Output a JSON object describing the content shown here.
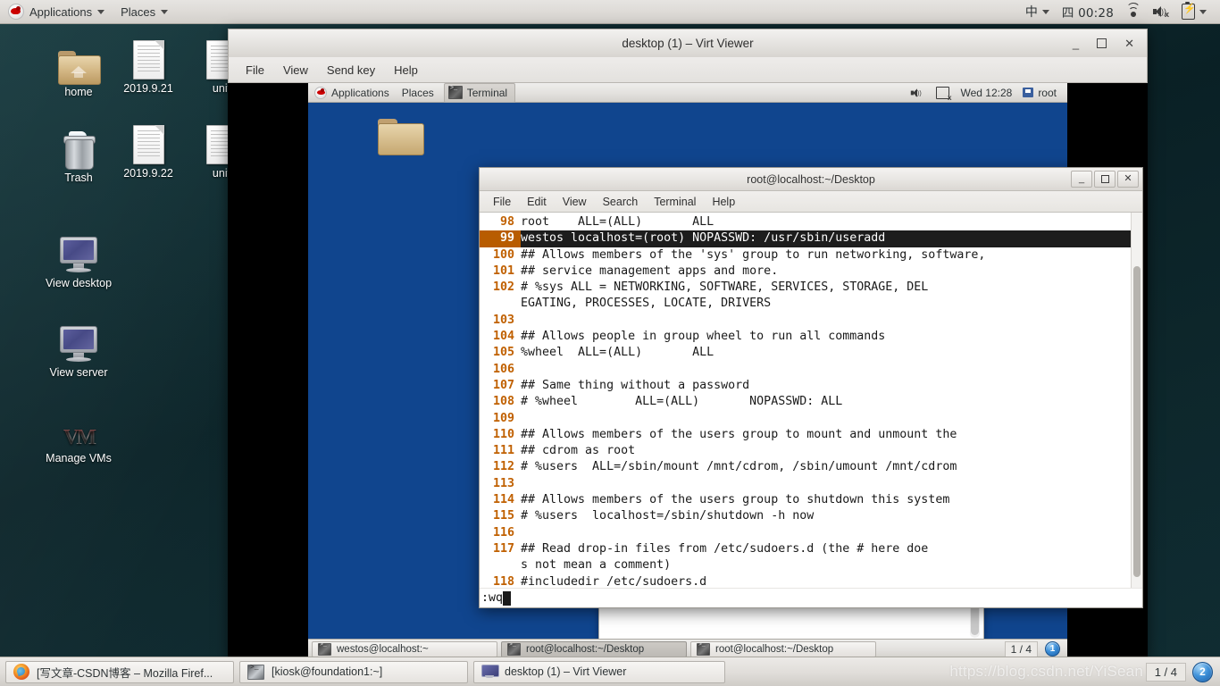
{
  "host_panel": {
    "applications": "Applications",
    "places": "Places",
    "ime": "中",
    "clock": "四 00:28",
    "icons": [
      "wifi-icon",
      "speaker-muted-icon",
      "battery-icon"
    ]
  },
  "desktop_icons": [
    {
      "label": "home",
      "icon": "home-folder-icon"
    },
    {
      "label": "2019.9.21",
      "icon": "text-document-icon"
    },
    {
      "label": "unit",
      "icon": "text-document-icon"
    },
    {
      "label": "Trash",
      "icon": "trash-icon"
    },
    {
      "label": "2019.9.22",
      "icon": "text-document-icon"
    },
    {
      "label": "unit",
      "icon": "text-document-icon"
    },
    {
      "label": "View desktop",
      "icon": "monitor-icon"
    },
    {
      "label": "View server",
      "icon": "monitor-icon"
    },
    {
      "label": "Manage VMs",
      "icon": "vmm-icon"
    }
  ],
  "virt_viewer": {
    "title": "desktop (1) – Virt Viewer",
    "menus": [
      "File",
      "View",
      "Send key",
      "Help"
    ],
    "window_buttons": {
      "minimize": "_",
      "maximize": "□",
      "close": "✕"
    }
  },
  "vm_panel": {
    "applications": "Applications",
    "places": "Places",
    "active_app": "Terminal",
    "clock": "Wed 12:28",
    "user": "root"
  },
  "vm_taskbar": {
    "items": [
      {
        "label": "westos@localhost:~",
        "active": false
      },
      {
        "label": "root@localhost:~/Desktop",
        "active": true
      },
      {
        "label": "root@localhost:~/Desktop",
        "active": false
      }
    ],
    "workspace": "1 / 4",
    "badge": "1"
  },
  "terminal": {
    "title": "root@localhost:~/Desktop",
    "menus": [
      "File",
      "Edit",
      "View",
      "Search",
      "Terminal",
      "Help"
    ],
    "window_buttons": {
      "minimize": "_",
      "maximize": "□",
      "close": "✕"
    },
    "status_line": ":wq",
    "lines": [
      {
        "num": "98",
        "text": "root    ALL=(ALL)       ALL",
        "highlight": false,
        "wrapped": false
      },
      {
        "num": "99",
        "text": "westos localhost=(root) NOPASSWD: /usr/sbin/useradd",
        "highlight": true,
        "wrapped": false
      },
      {
        "num": "100",
        "text": "## Allows members of the 'sys' group to run networking, software,",
        "highlight": false,
        "wrapped": false
      },
      {
        "num": "101",
        "text": "## service management apps and more.",
        "highlight": false,
        "wrapped": false
      },
      {
        "num": "102",
        "text": "# %sys ALL = NETWORKING, SOFTWARE, SERVICES, STORAGE, DELEGATING, PROCESSES, LOCATE, DRIVERS",
        "highlight": false,
        "wrapped": true
      },
      {
        "num": "103",
        "text": "",
        "highlight": false,
        "wrapped": false
      },
      {
        "num": "104",
        "text": "## Allows people in group wheel to run all commands",
        "highlight": false,
        "wrapped": false
      },
      {
        "num": "105",
        "text": "%wheel  ALL=(ALL)       ALL",
        "highlight": false,
        "wrapped": false
      },
      {
        "num": "106",
        "text": "",
        "highlight": false,
        "wrapped": false
      },
      {
        "num": "107",
        "text": "## Same thing without a password",
        "highlight": false,
        "wrapped": false
      },
      {
        "num": "108",
        "text": "# %wheel        ALL=(ALL)       NOPASSWD: ALL",
        "highlight": false,
        "wrapped": false
      },
      {
        "num": "109",
        "text": "",
        "highlight": false,
        "wrapped": false
      },
      {
        "num": "110",
        "text": "## Allows members of the users group to mount and unmount the",
        "highlight": false,
        "wrapped": false
      },
      {
        "num": "111",
        "text": "## cdrom as root",
        "highlight": false,
        "wrapped": false
      },
      {
        "num": "112",
        "text": "# %users  ALL=/sbin/mount /mnt/cdrom, /sbin/umount /mnt/cdrom",
        "highlight": false,
        "wrapped": false
      },
      {
        "num": "113",
        "text": "",
        "highlight": false,
        "wrapped": false
      },
      {
        "num": "114",
        "text": "## Allows members of the users group to shutdown this system",
        "highlight": false,
        "wrapped": false
      },
      {
        "num": "115",
        "text": "# %users  localhost=/sbin/shutdown -h now",
        "highlight": false,
        "wrapped": false
      },
      {
        "num": "116",
        "text": "",
        "highlight": false,
        "wrapped": false
      },
      {
        "num": "117",
        "text": "## Read drop-in files from /etc/sudoers.d (the # here does not mean a comment)",
        "highlight": false,
        "wrapped": true
      },
      {
        "num": "118",
        "text": "#includedir /etc/sudoers.d",
        "highlight": false,
        "wrapped": false
      }
    ]
  },
  "host_taskbar": {
    "items": [
      {
        "label": "[写文章-CSDN博客 – Mozilla Firef...",
        "icon": "firefox-icon"
      },
      {
        "label": "[kiosk@foundation1:~]",
        "icon": "terminal-icon"
      },
      {
        "label": "desktop (1) – Virt Viewer",
        "icon": "virt-viewer-icon"
      }
    ],
    "workspace": "1 / 4",
    "badge": "2"
  },
  "watermark": "https://blog.csdn.net/YiSean",
  "colors": {
    "desktop_bg": "#0d2b30",
    "vm_desktop_bg": "#10458e",
    "line_number": "#c06000",
    "highlight_bg": "#1d1d1d",
    "highlight_num_bg": "#b85c00"
  }
}
